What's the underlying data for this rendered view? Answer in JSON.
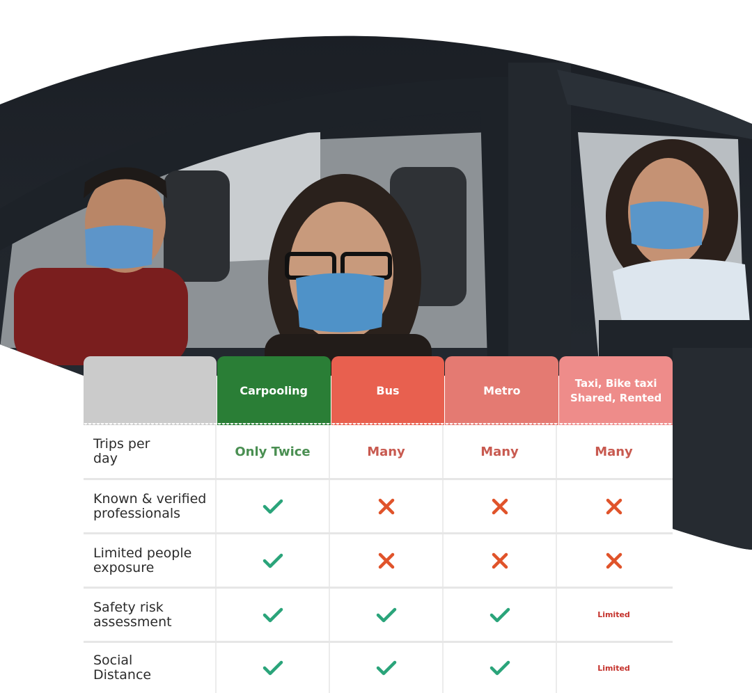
{
  "table": {
    "headers": [
      "",
      "Carpooling",
      "Bus",
      "Metro",
      "Taxi, Bike taxi\nShared, Rented"
    ],
    "rows": [
      {
        "label": "Trips per\nday",
        "values": [
          "Only Twice",
          "Many",
          "Many",
          "Many"
        ]
      },
      {
        "label": "Known & verified\nprofessionals",
        "values": [
          "check-icon",
          "cross-icon",
          "cross-icon",
          "cross-icon"
        ]
      },
      {
        "label": "Limited people\nexposure",
        "values": [
          "check-icon",
          "cross-icon",
          "cross-icon",
          "cross-icon"
        ]
      },
      {
        "label": "Safety risk\nassessment",
        "values": [
          "check-icon",
          "check-icon",
          "check-icon",
          "Limited"
        ]
      },
      {
        "label": "Social\nDistance",
        "values": [
          "check-icon",
          "check-icon",
          "check-icon",
          "Limited"
        ]
      }
    ]
  },
  "colors": {
    "carpooling": "#2a7e36",
    "bus": "#e8604f",
    "metro": "#e47a72",
    "taxi": "#ee8c8a",
    "check": "#2aa47a",
    "cross": "#e0532a"
  }
}
